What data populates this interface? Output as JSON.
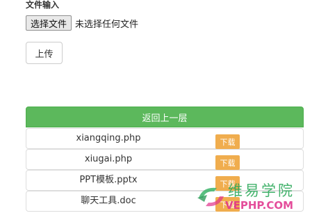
{
  "form": {
    "label": "文件输入",
    "choose_button": "选择文件",
    "no_file_text": "未选择任何文件",
    "upload_button": "上传"
  },
  "list": {
    "header": "返回上一层",
    "files": [
      {
        "name": "xiangqing.php",
        "download": "下载"
      },
      {
        "name": "xiugai.php",
        "download": "下载"
      },
      {
        "name": "PPT模板.pptx",
        "download": "下载"
      },
      {
        "name": "聊天工具.doc",
        "download": "下载"
      }
    ]
  },
  "watermark": {
    "cn": "维易学院",
    "en": "VEPHP.COM"
  },
  "colors": {
    "header_green": "#5cb85c",
    "download_orange": "#f0ad4e"
  }
}
